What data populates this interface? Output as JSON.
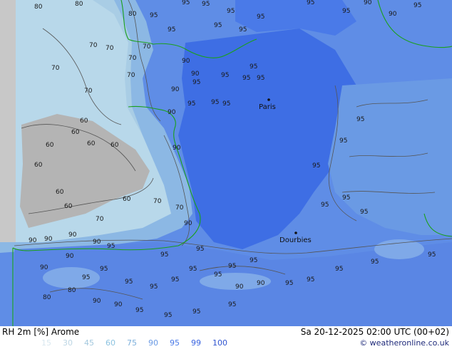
{
  "footer": {
    "title": "RH 2m [%] Arome",
    "datetime": "Sa 20-12-2025 02:00 UTC (00+02)",
    "credit": "© weatheronline.co.uk"
  },
  "legend": {
    "items": [
      {
        "value": "15",
        "color": "#d9e8f0"
      },
      {
        "value": "30",
        "color": "#bdd6e4"
      },
      {
        "value": "45",
        "color": "#a3c8de"
      },
      {
        "value": "60",
        "color": "#8cc3e0"
      },
      {
        "value": "75",
        "color": "#7db0dc"
      },
      {
        "value": "90",
        "color": "#6a9ae4"
      },
      {
        "value": "95",
        "color": "#4a7ae8"
      },
      {
        "value": "99",
        "color": "#3a64e0"
      },
      {
        "value": "100",
        "color": "#2f54d0"
      }
    ]
  },
  "cities": [
    {
      "name": "Paris"
    },
    {
      "name": "Dourbies"
    }
  ],
  "contour_labels": [
    "80",
    "80",
    "80",
    "95",
    "95",
    "95",
    "95",
    "95",
    "95",
    "90",
    "90",
    "95",
    "95",
    "95",
    "95",
    "95",
    "70",
    "70",
    "70",
    "70",
    "90",
    "90",
    "90",
    "95",
    "95",
    "95",
    "95",
    "70",
    "70",
    "70",
    "90",
    "95",
    "95",
    "95",
    "95",
    "60",
    "60",
    "60",
    "60",
    "60",
    "60",
    "90",
    "95",
    "95",
    "95",
    "60",
    "60",
    "60",
    "70",
    "70",
    "70",
    "90",
    "95",
    "95",
    "95",
    "90",
    "90",
    "90",
    "90",
    "95",
    "95",
    "95",
    "95",
    "95",
    "90",
    "90",
    "95",
    "95",
    "95",
    "95",
    "95",
    "95",
    "95",
    "90",
    "90",
    "95",
    "95",
    "95",
    "95",
    "95",
    "80",
    "80",
    "90",
    "90",
    "95",
    "95",
    "95",
    "95"
  ],
  "colors": {
    "land_dry": "#a9cde5",
    "land_moist": "#8cb8e4",
    "land_humid": "#5f8de6",
    "land_saturated": "#3e6ee4",
    "sea_grey": "#b4b4b4",
    "coast": "#1aa01a",
    "contour": "#555555"
  }
}
